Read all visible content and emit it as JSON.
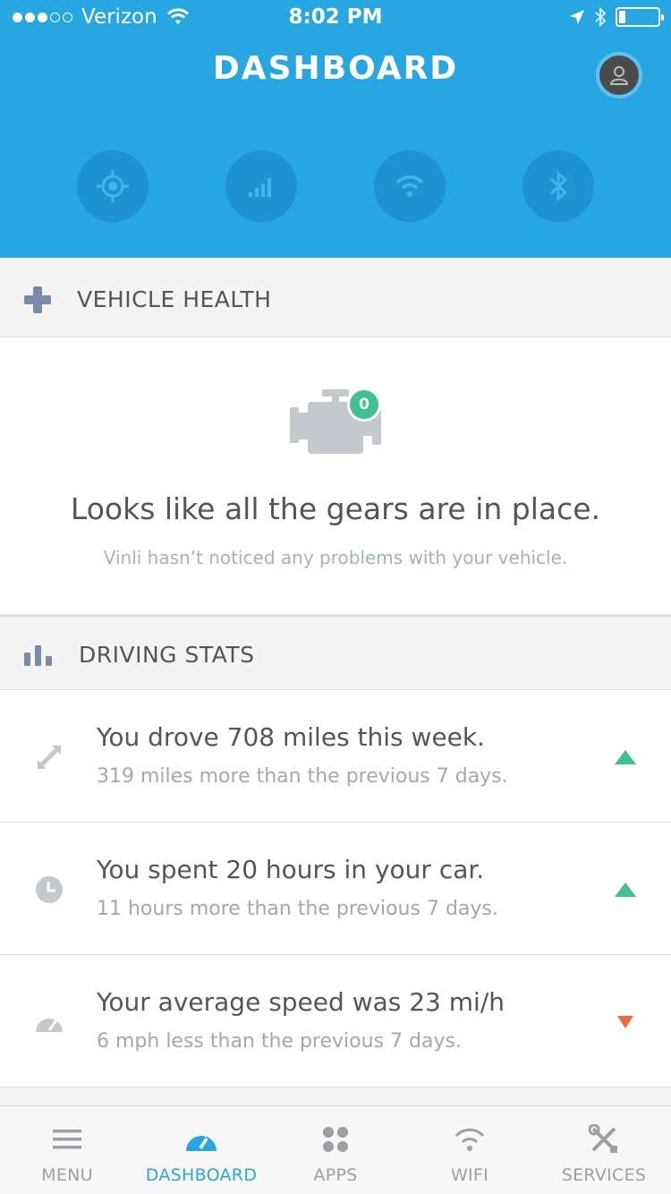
{
  "status_bar": {
    "carrier": "Verizon",
    "time": "8:02 PM"
  },
  "header": {
    "title": "DASHBOARD",
    "quick_actions": [
      "locate-icon",
      "signal-bars-icon",
      "wifi-icon",
      "bluetooth-icon"
    ]
  },
  "vehicle_health": {
    "title": "VEHICLE HEALTH",
    "issue_count": "0",
    "message": "Looks like all the gears are in place.",
    "sub_message": "Vinli hasn’t noticed any problems with your vehicle."
  },
  "driving_stats": {
    "title": "DRIVING STATS",
    "items": [
      {
        "title": "You drove 708 miles this week.",
        "subtitle": "319 miles more than the previous 7 days.",
        "trend": "up",
        "icon": "expand-arrows-icon"
      },
      {
        "title": "You spent 20 hours in your car.",
        "subtitle": "11 hours more than the previous 7 days.",
        "trend": "up",
        "icon": "clock-icon"
      },
      {
        "title": "Your average speed was 23 mi/h",
        "subtitle": "6 mph less than the previous 7 days.",
        "trend": "down",
        "icon": "speedometer-icon"
      }
    ]
  },
  "tabs": [
    {
      "label": "MENU",
      "icon": "menu-icon",
      "active": false
    },
    {
      "label": "DASHBOARD",
      "icon": "dashboard-icon",
      "active": true
    },
    {
      "label": "APPS",
      "icon": "apps-icon",
      "active": false
    },
    {
      "label": "WIFI",
      "icon": "wifi-icon",
      "active": false
    },
    {
      "label": "SERVICES",
      "icon": "tools-icon",
      "active": false
    }
  ],
  "colors": {
    "header_blue": "#27a7e1",
    "trend_up": "#3fc28f",
    "trend_down": "#ef6a3c",
    "badge_green": "#3fc28f"
  }
}
